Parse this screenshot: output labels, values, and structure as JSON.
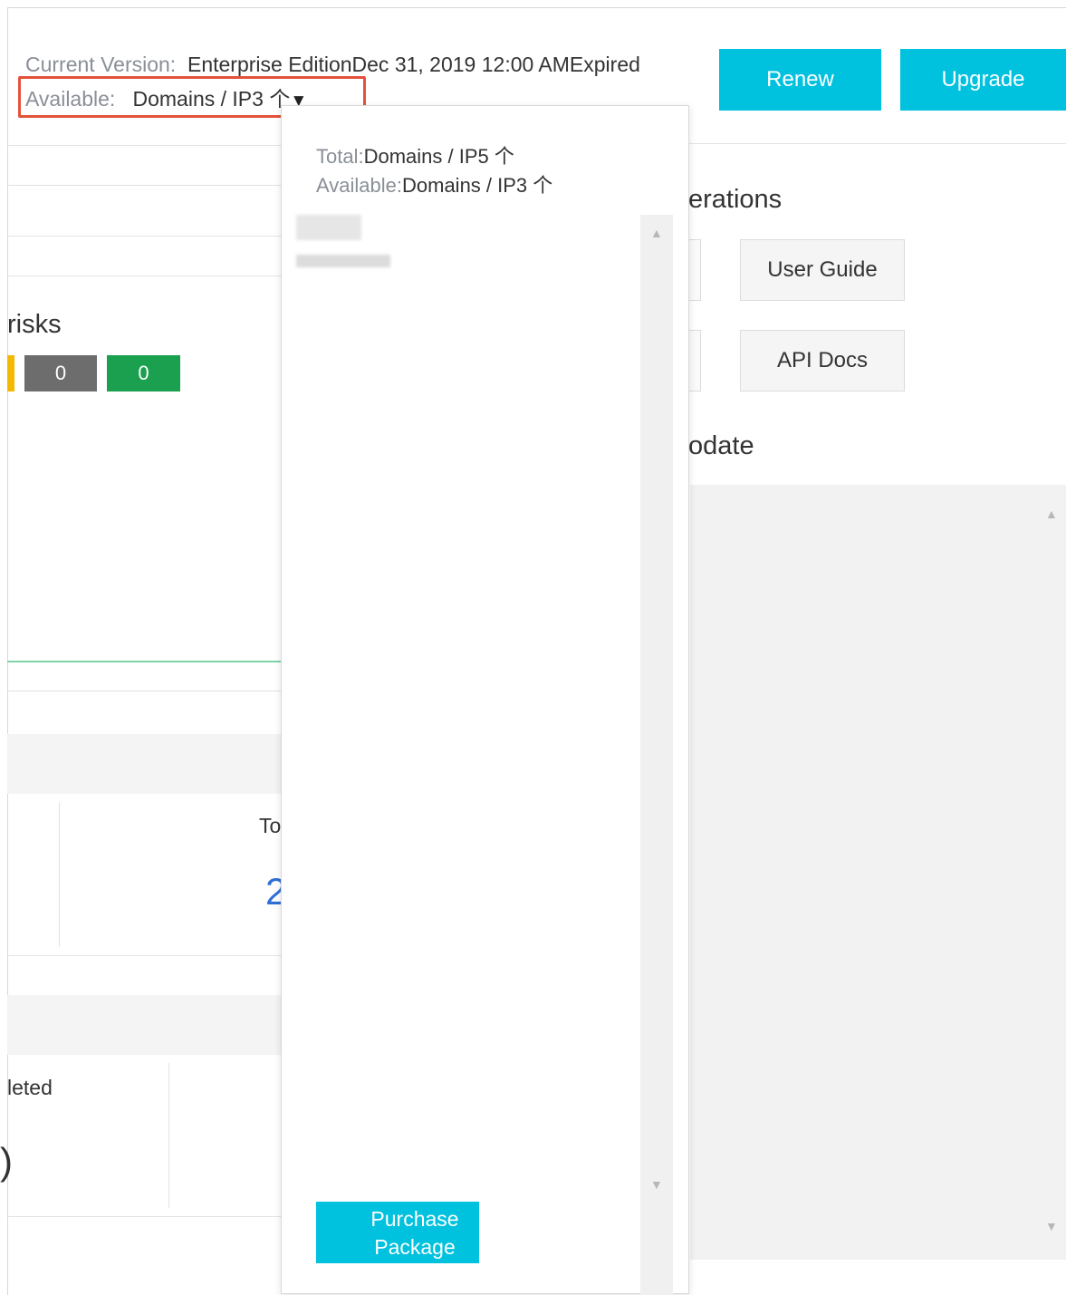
{
  "header": {
    "version_label": "Current Version:",
    "version_value": "Enterprise EditionDec 31, 2019 12:00 AMExpired",
    "available_label": "Available:",
    "available_value": "Domains / IP3 个",
    "dropdown_icon": "caret-down-icon",
    "renew_label": "Renew",
    "upgrade_label": "Upgrade"
  },
  "popover": {
    "total_label": "Total:",
    "total_value": "Domains / IP5 个",
    "available_label": "Available:",
    "available_value": "Domains / IP3 个",
    "purchase_label": "Purchase Package"
  },
  "risks": {
    "title_fragment": "risks",
    "badges": [
      {
        "value": "0",
        "color": "#6d6d6d"
      },
      {
        "value": "0",
        "color": "#1aa04f"
      }
    ],
    "accent_color": "#f5b800"
  },
  "operations": {
    "title_fragment": "erations",
    "user_guide_label": "User Guide",
    "api_docs_label": "API Docs"
  },
  "update": {
    "title_fragment": "odate"
  },
  "fragments": {
    "to_text": "To",
    "number_fragment": "2",
    "completed_fragment": "leted",
    "paren_fragment": ")"
  },
  "colors": {
    "primary": "#00c1de",
    "highlight_border": "#e4523a"
  }
}
